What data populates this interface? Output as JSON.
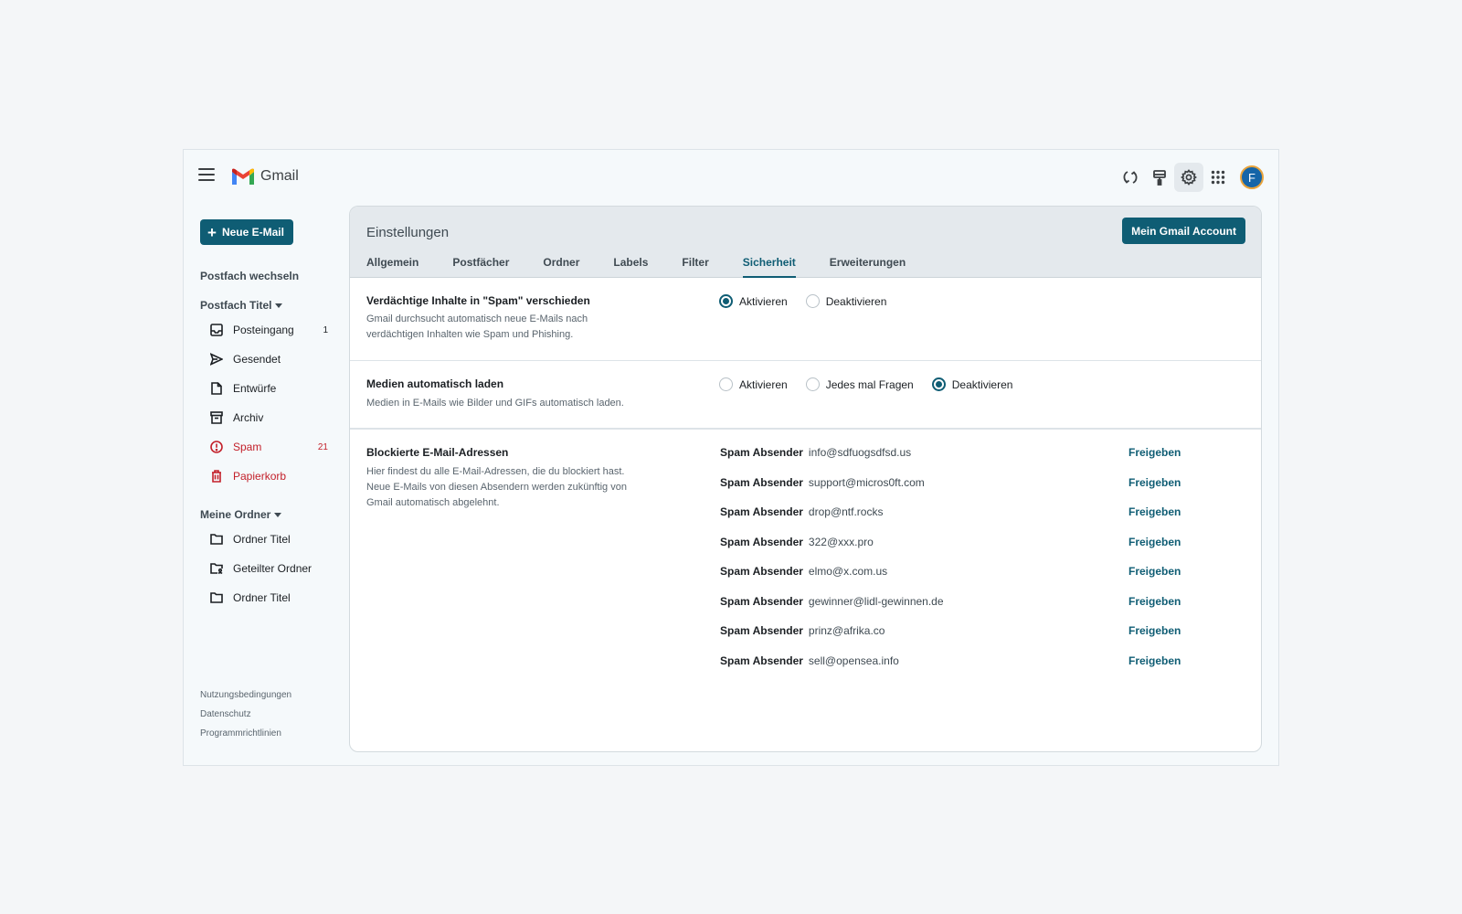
{
  "app": {
    "title": "Gmail",
    "avatar_initial": "F"
  },
  "topbar": {
    "icons": [
      "sync-icon",
      "paint-roller-icon",
      "gear-icon",
      "apps-grid-icon"
    ]
  },
  "sidebar": {
    "compose_label": "Neue E-Mail",
    "switch_mailbox": "Postfach wechseln",
    "mailbox_title": "Postfach Titel",
    "mailbox_items": [
      {
        "label": "Posteingang",
        "count": "1",
        "icon": "inbox-icon"
      },
      {
        "label": "Gesendet",
        "count": "",
        "icon": "send-icon"
      },
      {
        "label": "Entwürfe",
        "count": "",
        "icon": "draft-icon"
      },
      {
        "label": "Archiv",
        "count": "",
        "icon": "archive-icon"
      },
      {
        "label": "Spam",
        "count": "21",
        "icon": "alert-icon"
      },
      {
        "label": "Papierkorb",
        "count": "",
        "icon": "trash-icon"
      }
    ],
    "my_folders_title": "Meine Ordner",
    "folder_items": [
      {
        "label": "Ordner Titel",
        "icon": "folder-icon"
      },
      {
        "label": "Geteilter Ordner",
        "icon": "shared-folder-icon"
      },
      {
        "label": "Ordner Titel",
        "icon": "folder-icon"
      }
    ],
    "footer": [
      "Nutzungsbedingungen",
      "Datenschutz",
      "Programmrichtlinien"
    ]
  },
  "settings": {
    "title": "Einstellungen",
    "account_button": "Mein Gmail Account",
    "tabs": [
      "Allgemein",
      "Postfächer",
      "Ordner",
      "Labels",
      "Filter",
      "Sicherheit",
      "Erweiterungen"
    ],
    "active_tab": "Sicherheit",
    "spam_section": {
      "title": "Verdächtige Inhalte in \"Spam\" verschieden",
      "description": "Gmail durchsucht automatisch neue E-Mails nach verdächtigen Inhalten wie Spam und Phishing.",
      "options": [
        "Aktivieren",
        "Deaktivieren"
      ],
      "selected": "Aktivieren"
    },
    "media_section": {
      "title": "Medien automatisch laden",
      "description": "Medien in E-Mails wie Bilder und GIFs automatisch laden.",
      "options": [
        "Aktivieren",
        "Jedes mal Fragen",
        "Deaktivieren"
      ],
      "selected": "Deaktivieren"
    },
    "blocked_section": {
      "title": "Blockierte E-Mail-Adressen",
      "description": "Hier findest du alle E-Mail-Adressen, die du blockiert hast. Neue E-Mails von diesen Absendern werden zukünftig von Gmail automatisch abgelehnt.",
      "row_label": "Spam Absender",
      "release_label": "Freigeben",
      "addresses": [
        "info@sdfuogsdfsd.us",
        "support@micros0ft.com",
        "drop@ntf.rocks",
        "322@xxx.pro",
        "elmo@x.com.us",
        "gewinner@lidl-gewinnen.de",
        "prinz@afrika.co",
        "sell@opensea.info"
      ]
    }
  },
  "colors": {
    "accent": "#0f5d74",
    "danger": "#c3202a"
  }
}
